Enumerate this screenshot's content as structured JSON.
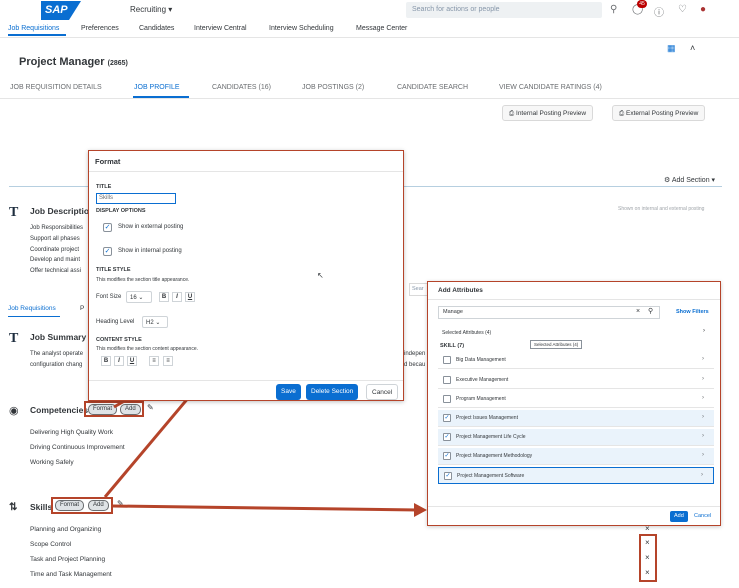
{
  "shell": {
    "logo": "SAP",
    "module": "Recruiting ▾",
    "search_placeholder": "Search for actions or people",
    "notification_count": "45"
  },
  "menu": [
    "Job Requisitions",
    "Preferences",
    "Candidates",
    "Interview Central",
    "Interview Scheduling",
    "Message Center"
  ],
  "header": {
    "title": "Project Manager",
    "req_id": "(2865)",
    "tabs": [
      "JOB REQUISITION DETAILS",
      "JOB PROFILE",
      "CANDIDATES (16)",
      "JOB POSTINGS (2)",
      "CANDIDATE SEARCH",
      "VIEW CANDIDATE RATINGS (4)"
    ],
    "internal_preview": "Internal Posting Preview",
    "external_preview": "External Posting Preview"
  },
  "content": {
    "add_section": "Add Section",
    "job_description_title": "Job Description",
    "job_description_lines": [
      "Job Responsibilities",
      "Support all phases",
      "Coordinate project",
      "Develop and maint",
      "Offer technical assi"
    ],
    "shown_note": "Shown on internal and external posting",
    "subnav": [
      "Job Requisitions",
      "P"
    ],
    "job_summary_title": "Job Summary",
    "job_summary_lines": [
      "The analyst operate",
      "configuration chang"
    ],
    "job_summary_right": [
      "indepen",
      "d becau"
    ],
    "competencies_title": "Competencies",
    "competencies": [
      "Delivering High Quality Work",
      "Driving Continuous Improvement",
      "Working Safely"
    ],
    "skills_title": "Skills",
    "skills": [
      "Planning and Organizing",
      "Scope Control",
      "Task and Project Planning",
      "Time and Task Management"
    ],
    "format_label": "Format",
    "add_label": "Add"
  },
  "format_dialog": {
    "title": "Format",
    "title_label": "TITLE",
    "title_value": "Skills",
    "display_options": "DISPLAY OPTIONS",
    "show_external": "Show in external posting",
    "show_internal": "Show in internal posting",
    "title_style": "TITLE STYLE",
    "title_style_desc": "This modifies the section title appearance.",
    "font_size_label": "Font Size",
    "font_size_value": "16",
    "heading_level_label": "Heading Level",
    "heading_level_value": "H2",
    "content_style": "CONTENT STYLE",
    "content_style_desc": "This modifies the section content appearance.",
    "save": "Save",
    "delete_section": "Delete Section",
    "cancel": "Cancel"
  },
  "attributes_dialog": {
    "title": "Add Attributes",
    "search_value": "Manage",
    "show_filters": "Show Filters",
    "selected_attributes": "Selected Attributes (4)",
    "tooltip": "Selected Attributes (4)",
    "group_label": "SKILL (7)",
    "rows": [
      {
        "label": "Big Data Management",
        "checked": false
      },
      {
        "label": "Executive Management",
        "checked": false
      },
      {
        "label": "Program Management",
        "checked": false
      },
      {
        "label": "Project Issues Management",
        "checked": true
      },
      {
        "label": "Project Management Life Cycle",
        "checked": true
      },
      {
        "label": "Project Management Methodology",
        "checked": true
      },
      {
        "label": "Project Management Software",
        "checked": true
      }
    ],
    "add": "Add",
    "cancel": "Cancel"
  },
  "colors": {
    "accent": "#0a6ed1",
    "annotation": "#b5442a"
  }
}
